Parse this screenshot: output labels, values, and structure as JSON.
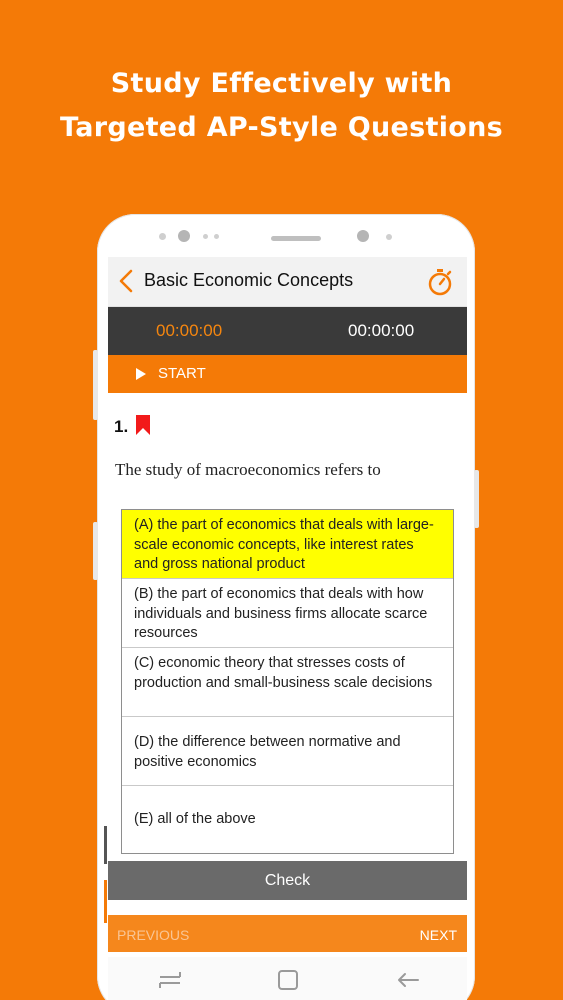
{
  "headline": {
    "line1": "Study Effectively with",
    "line2": "Targeted AP-Style Questions"
  },
  "appbar": {
    "title": "Basic Economic Concepts",
    "back_icon": "chevron-left-icon",
    "timer_icon": "stopwatch-icon"
  },
  "timers": {
    "question_time": "00:00:00",
    "total_time": "00:00:00"
  },
  "start_label": "START",
  "question": {
    "number": "1.",
    "bookmark_icon": "bookmark-icon",
    "text": "The study of macroeconomics refers to",
    "options": [
      {
        "text": "(A) the part of economics that deals with large-scale economic concepts, like interest rates and gross national product",
        "selected": true
      },
      {
        "text": "(B) the part of economics that deals with how individuals and business firms allocate scarce resources",
        "selected": false
      },
      {
        "text": "(C) economic theory that stresses costs of production and small-business scale decisions",
        "selected": false
      },
      {
        "text": "(D) the difference between normative and positive economics",
        "selected": false
      },
      {
        "text": "(E) all of the above",
        "selected": false
      }
    ]
  },
  "check_label": "Check",
  "nav": {
    "previous_label": "PREVIOUS",
    "next_label": "NEXT"
  },
  "colors": {
    "brand_orange": "#f47a07",
    "timer_bar": "#3a3a3a",
    "selected_highlight": "#ffff00",
    "check_button": "#6a6a6a"
  }
}
